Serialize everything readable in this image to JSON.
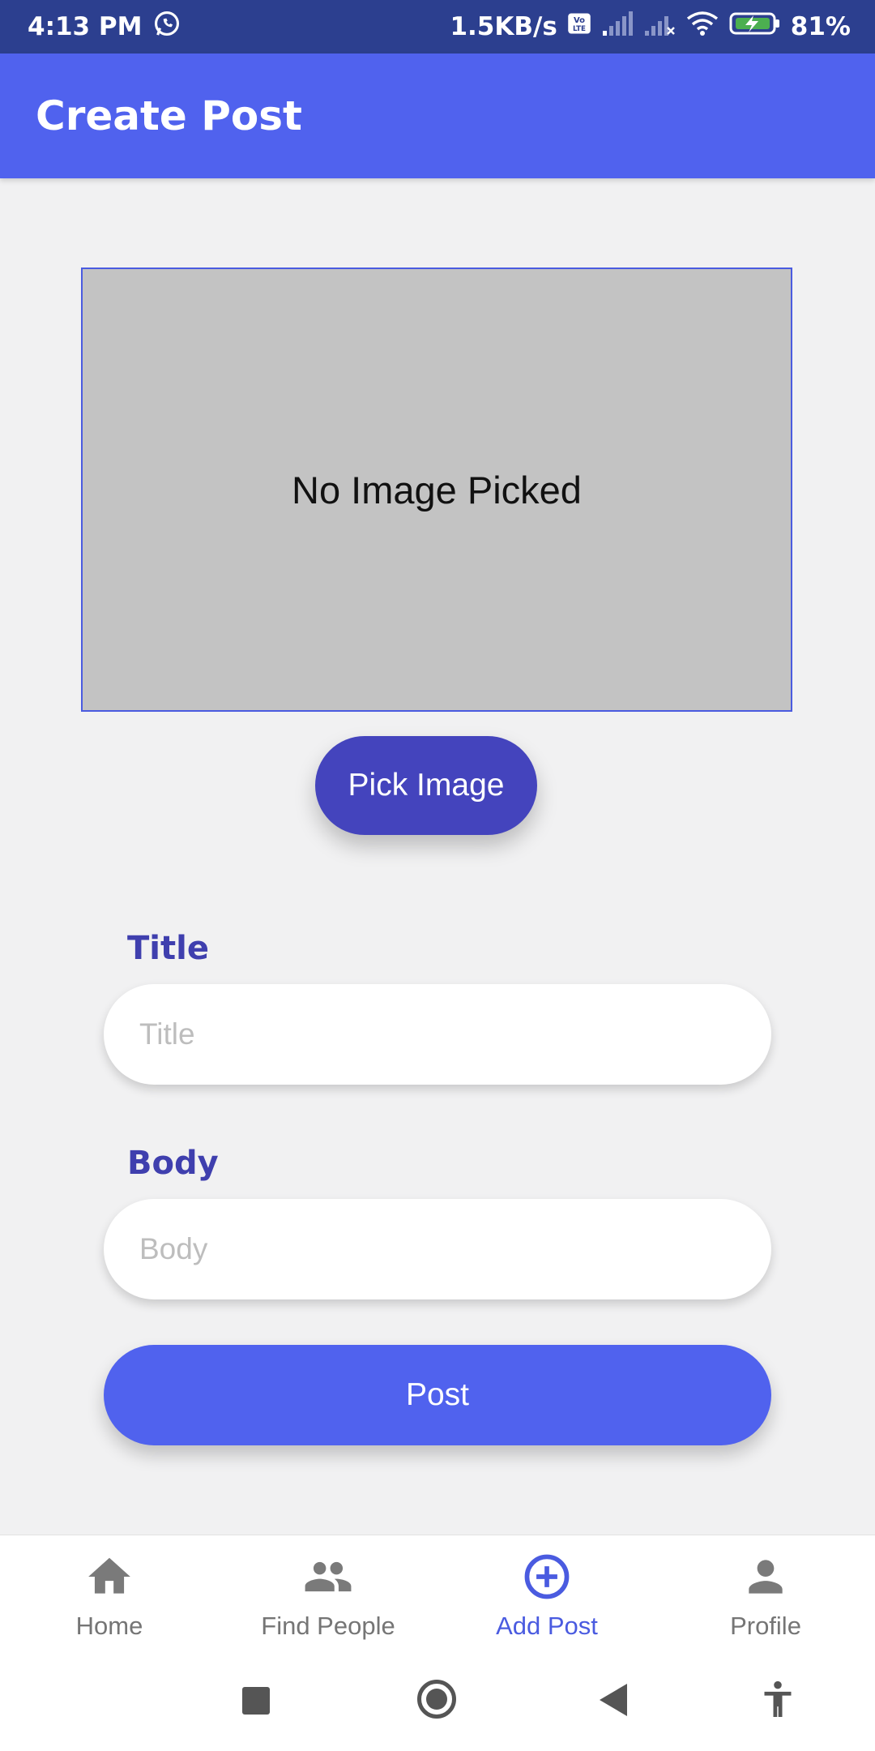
{
  "status_bar": {
    "time": "4:13 PM",
    "net_speed": "1.5KB/s",
    "battery": "81%",
    "icons": [
      "whatsapp-icon",
      "volte-icon",
      "signal-icon",
      "signal-no-service-icon",
      "wifi-icon",
      "battery-charging-icon"
    ]
  },
  "appbar": {
    "title": "Create Post"
  },
  "image_picker": {
    "placeholder_text": "No Image Picked",
    "button_label": "Pick Image"
  },
  "form": {
    "title_label": "Title",
    "title_placeholder": "Title",
    "title_value": "",
    "body_label": "Body",
    "body_placeholder": "Body",
    "body_value": "",
    "submit_label": "Post"
  },
  "bottom_nav": {
    "items": [
      {
        "label": "Home",
        "icon": "home-icon",
        "active": false
      },
      {
        "label": "Find People",
        "icon": "people-icon",
        "active": false
      },
      {
        "label": "Add Post",
        "icon": "add-circle-icon",
        "active": true
      },
      {
        "label": "Profile",
        "icon": "person-icon",
        "active": false
      }
    ]
  },
  "system_nav": {
    "icons": [
      "recents-icon",
      "home-circle-icon",
      "back-icon",
      "accessibility-icon"
    ]
  },
  "colors": {
    "app_bar": "#5062ee",
    "status_bar": "#2c3f8f",
    "pick_button": "#4444bd",
    "label": "#3f3fae",
    "active_nav": "#4a5be0",
    "image_placeholder": "#c3c3c3"
  }
}
